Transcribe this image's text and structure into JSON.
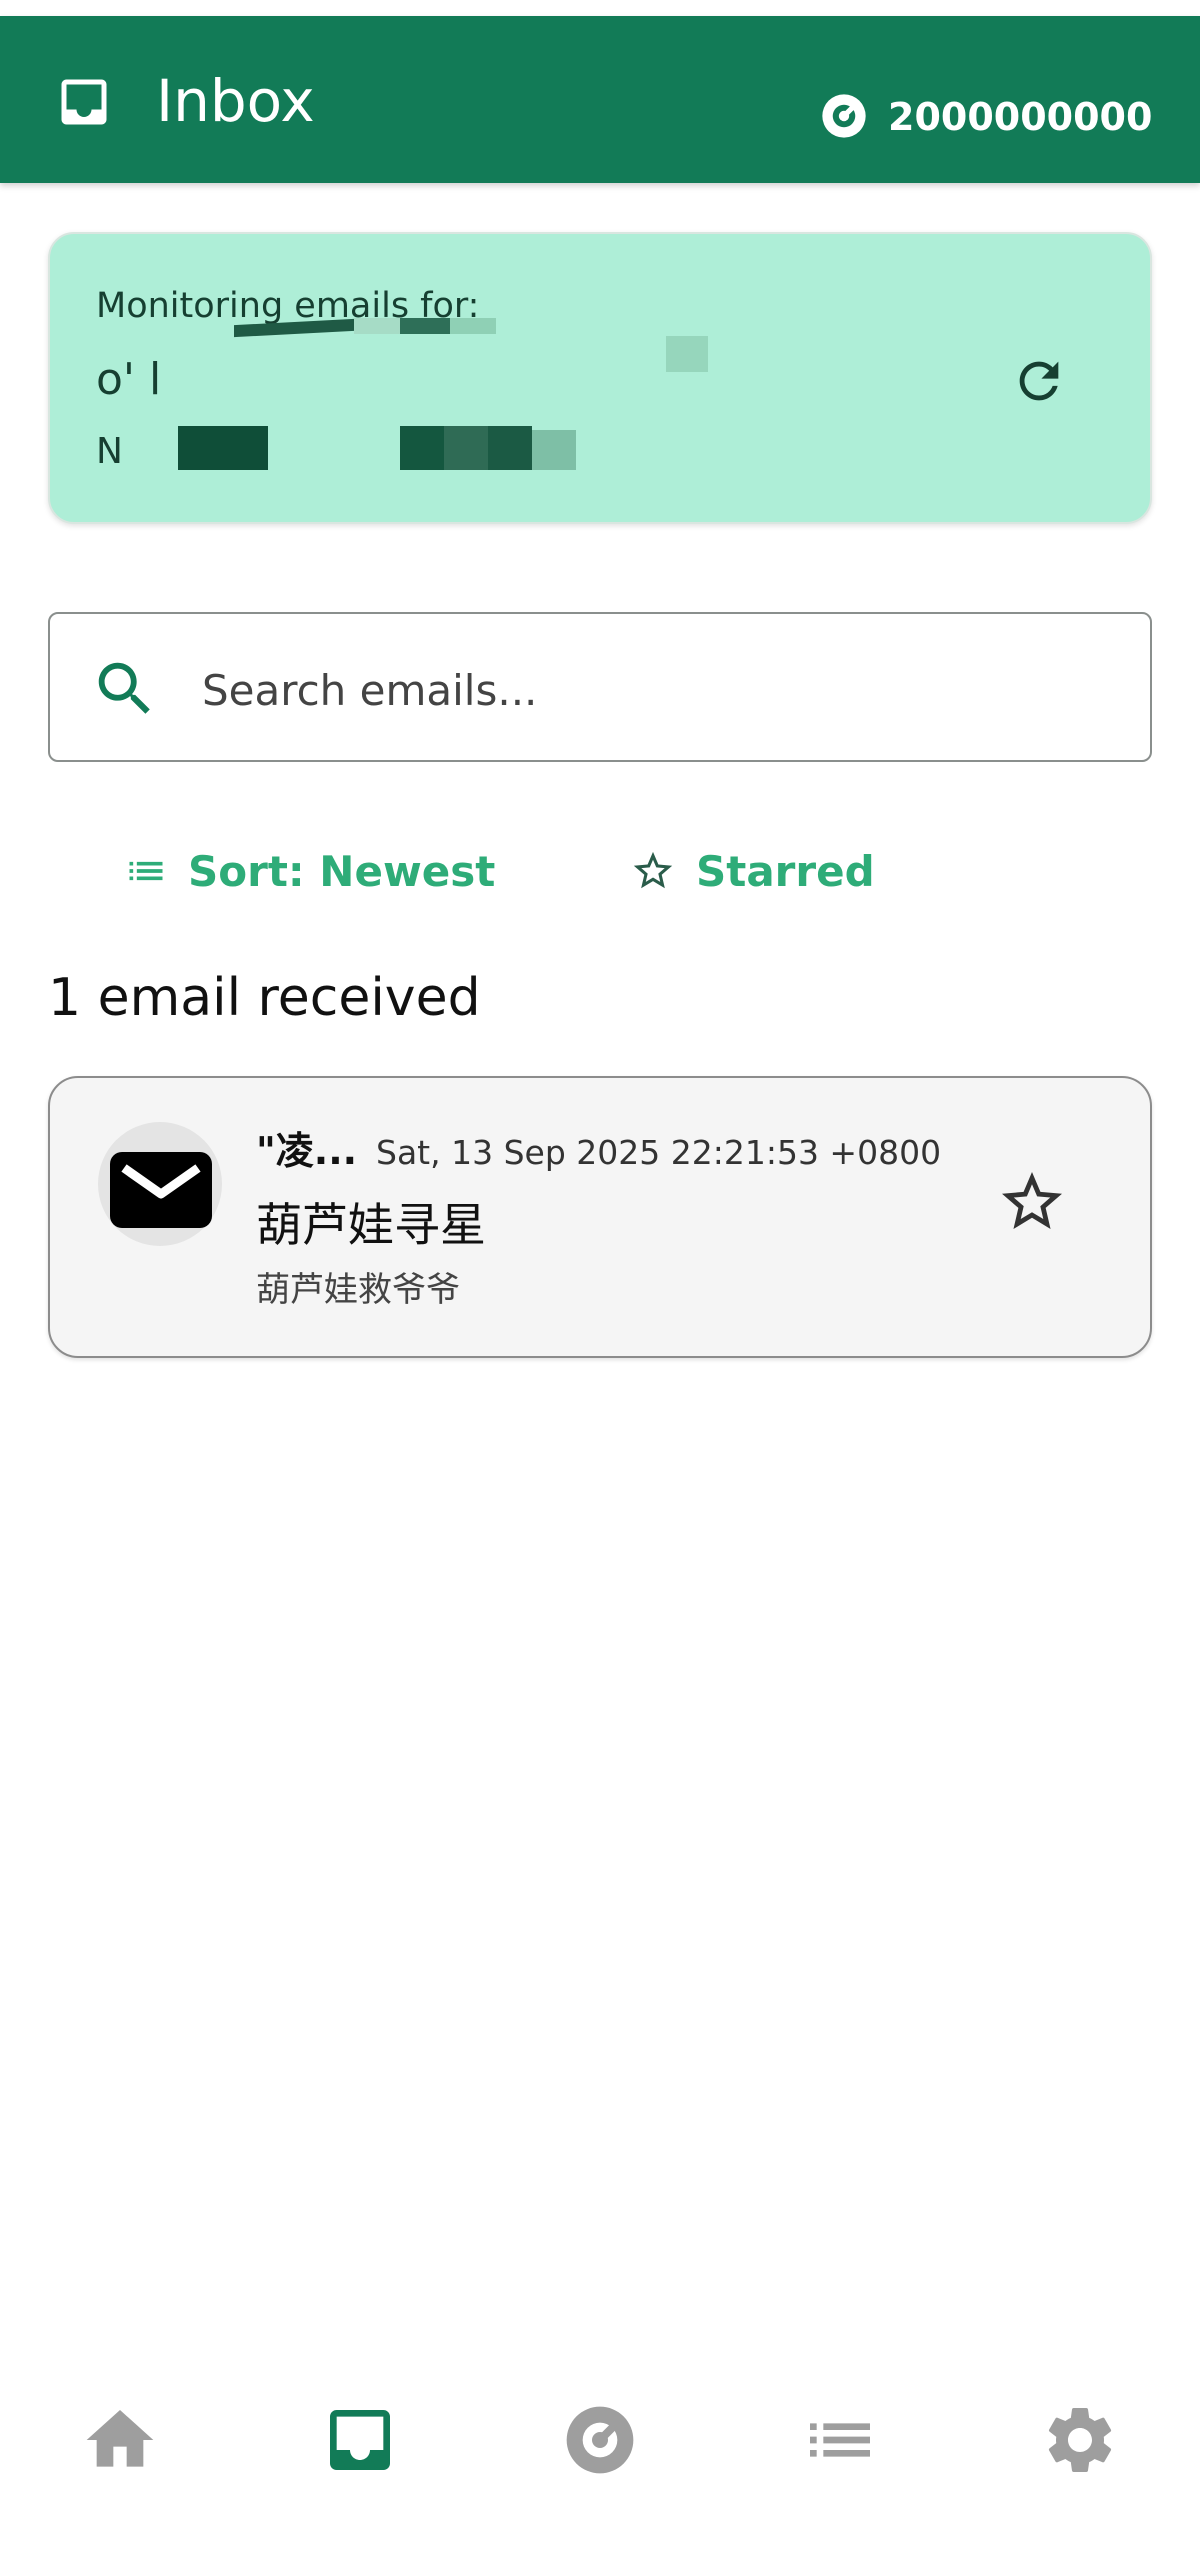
{
  "app_bar": {
    "title": "Inbox",
    "credit_value": "2000000000",
    "color": "#127b57"
  },
  "monitor": {
    "label": "Monitoring emails for:",
    "address_line_1": "o'                                   l",
    "address_line_2": "N",
    "background": "#aeeed7"
  },
  "search": {
    "placeholder": "Search emails..."
  },
  "filters": {
    "sort_label": "Sort: Newest",
    "starred_label": "Starred",
    "accent": "#2eac78"
  },
  "email_count_label": "1 email received",
  "emails": [
    {
      "sender": "\"凌...",
      "date": "Sat, 13 Sep 2025 22:21:53 +0800",
      "subject": "葫芦娃寻星",
      "preview": "葫芦娃救爷爷",
      "starred": false
    }
  ],
  "bottom_nav": {
    "items": [
      {
        "icon": "home-icon",
        "active": false
      },
      {
        "icon": "inbox-icon",
        "active": true
      },
      {
        "icon": "credit-icon",
        "active": false
      },
      {
        "icon": "list-icon",
        "active": false
      },
      {
        "icon": "settings-icon",
        "active": false
      }
    ],
    "active_color": "#127b57",
    "inactive_color": "#9e9e9e"
  }
}
